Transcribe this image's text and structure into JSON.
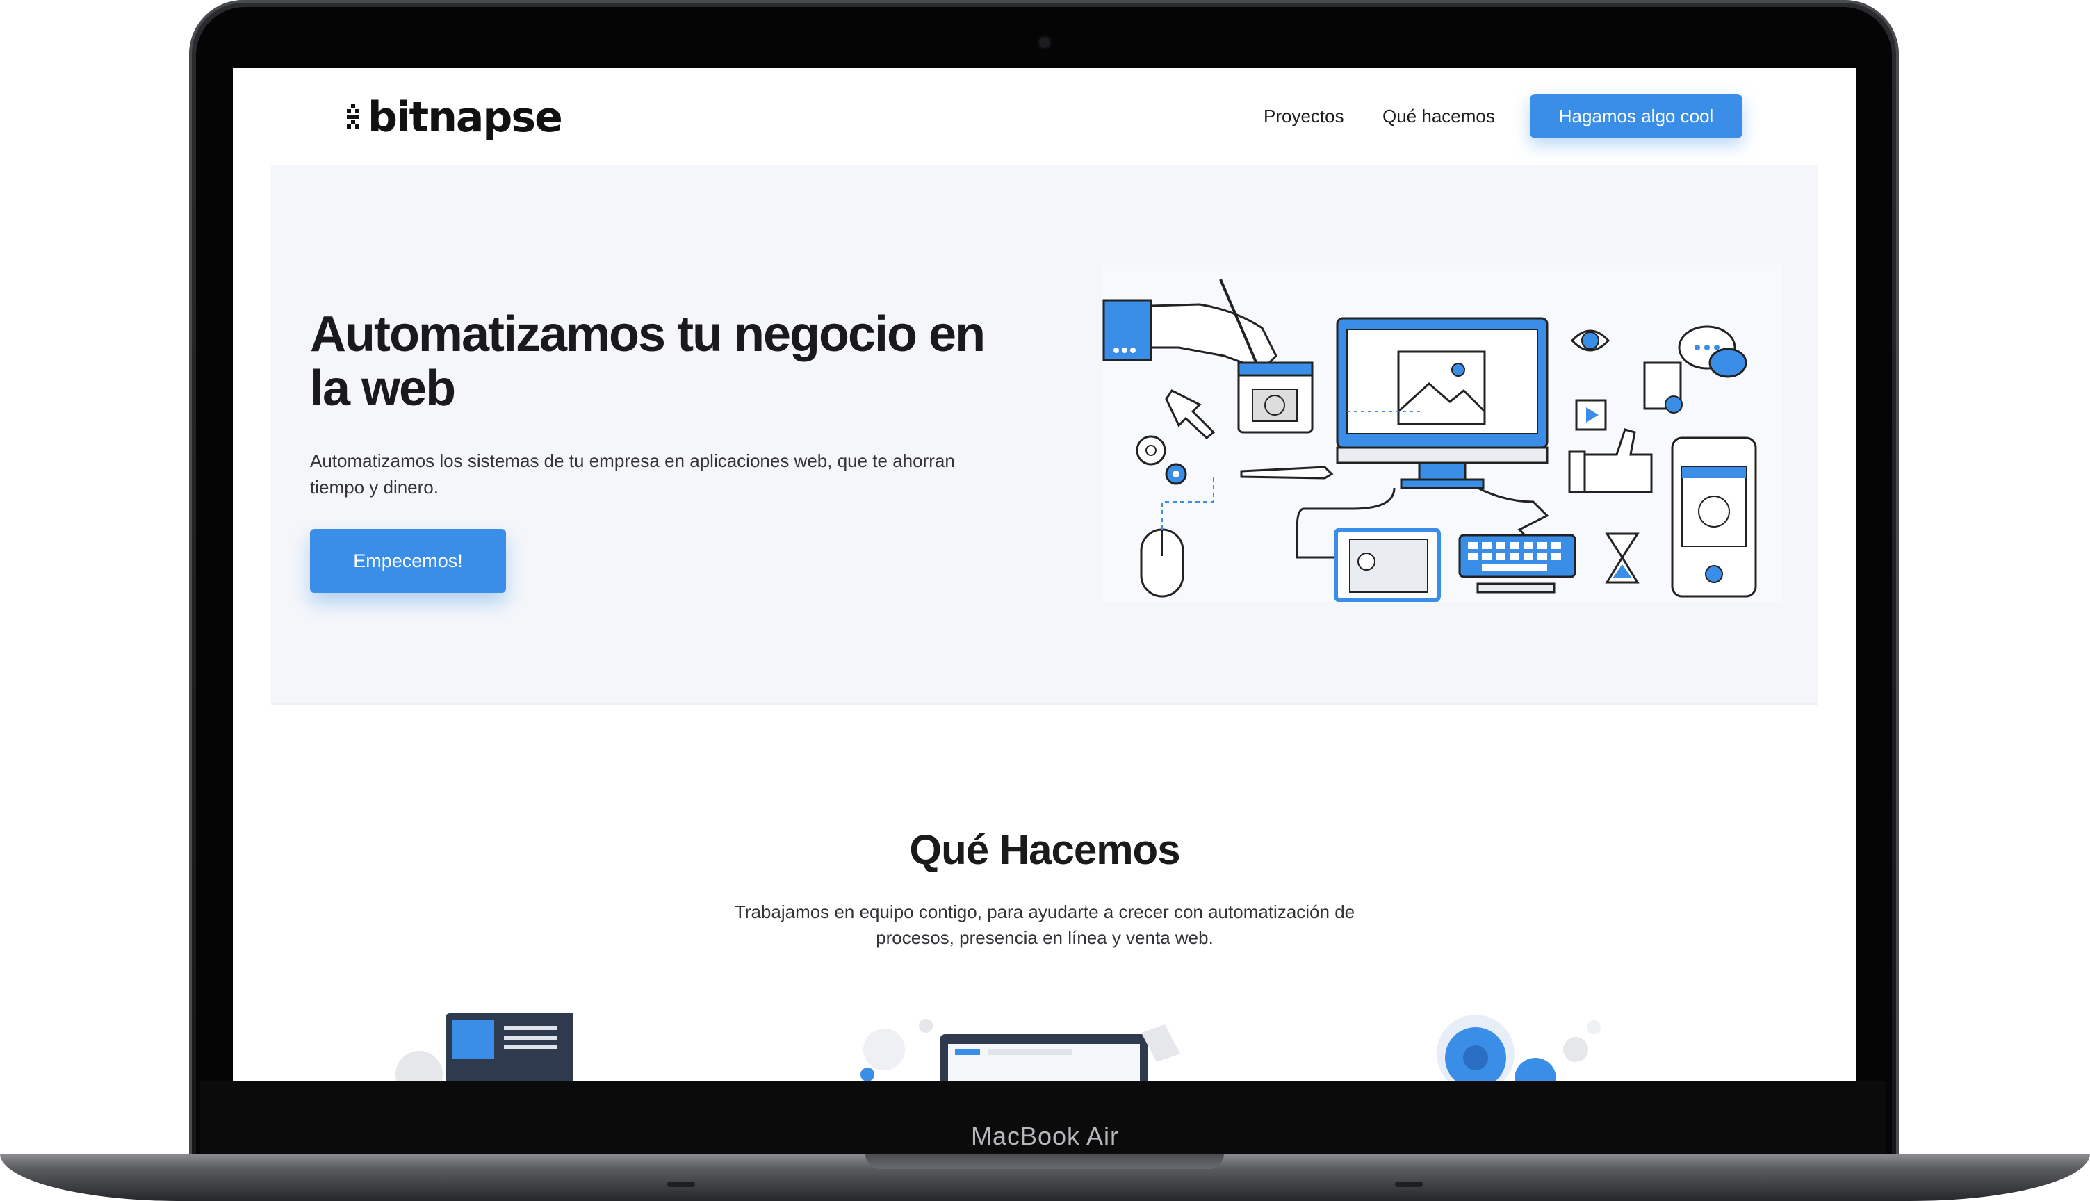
{
  "device": {
    "model_label": "MacBook Air"
  },
  "nav": {
    "logo_text": "bitnapse",
    "links": [
      {
        "label": "Proyectos"
      },
      {
        "label": "Qué hacemos"
      }
    ],
    "cta_label": "Hagamos algo cool"
  },
  "hero": {
    "title": "Automatizamos tu negocio en la web",
    "subtitle": "Automatizamos los sistemas de tu empresa en aplicaciones web, que te ahorran tiempo y dinero.",
    "cta_label": "Empecemos!",
    "illustration": "workstation-illustration"
  },
  "services": {
    "title": "Qué Hacemos",
    "subtitle": "Trabajamos en equipo contigo, para ayudarte a crecer con automatización de procesos, presencia en línea y venta web.",
    "cards": [
      {
        "illustration": "web-devices-illustration"
      },
      {
        "illustration": "ecommerce-illustration"
      },
      {
        "illustration": "seo-gears-illustration"
      }
    ]
  },
  "colors": {
    "accent": "#3a8ee8",
    "hero_background": "#f4f6fa",
    "text": "#1a1a1c"
  }
}
